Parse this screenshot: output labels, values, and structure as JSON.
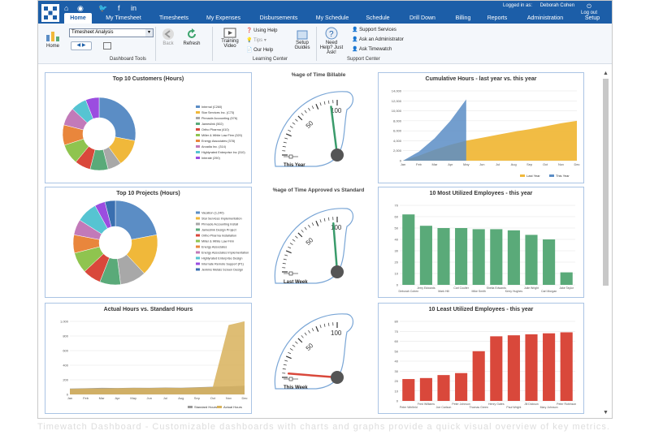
{
  "header": {
    "user_label": "Logged in as:",
    "user_name": "Deborah Cohen",
    "logout_label": "Log out",
    "tabs": [
      "Home",
      "My Timesheet",
      "Timesheets",
      "My Expenses",
      "Disbursements",
      "My Schedule",
      "Schedule",
      "Drill Down",
      "Billing",
      "Reports",
      "Administration",
      "Setup"
    ],
    "active_tab": "Home"
  },
  "ribbon": {
    "home_label": "Home",
    "dashboard_select": "Timesheet Analysis",
    "dashboard_tools_label": "Dashboard Tools",
    "back_label": "Back",
    "refresh_label": "Refresh",
    "training_label": "Training Video",
    "using_help_label": "Using Help",
    "tips_label": "Tips",
    "our_help_label": "Our Help",
    "setup_guides_label": "Setup Guides",
    "learning_center_label": "Learning Center",
    "need_help_label": "Need Help? Just Ask!",
    "support_services_label": "Support Services",
    "ask_admin_label": "Ask an Administrator",
    "ask_timewatch_label": "Ask Timewatch",
    "support_center_label": "Support Center"
  },
  "colors": {
    "brand": "#1c5ea8",
    "panel_border": "#aac4e4",
    "green_bar": "#5aaa79",
    "red_bar": "#d9483b",
    "area_blue": "#5b8dc5",
    "area_gold": "#f0b83a"
  },
  "panels": {
    "customers_title": "Top 10 Customers (Hours)",
    "projects_title": "Top 10 Projects (Hours)",
    "actual_title": "Actual Hours vs. Standard Hours",
    "billable_title": "%age of Time Billable",
    "approved_title": "%age of Time Approved vs Standard",
    "cumulative_title": "Cumulative Hours - last year vs. this year",
    "most_util_title": "10 Most Utilized Employees - this year",
    "least_util_title": "10 Least Utilized Employees - this year"
  },
  "gauges": [
    {
      "label": "This Year",
      "tick_50": "50",
      "tick_100": "100",
      "value": 92
    },
    {
      "label": "Last Week",
      "tick_50": "50",
      "tick_100": "100",
      "value": 95
    },
    {
      "label": "This Week",
      "tick_50": "50",
      "tick_100": "100",
      "value": 5
    }
  ],
  "chart_data": [
    {
      "type": "pie",
      "title": "Top 10 Customers (Hours)",
      "categories": [
        "Internal (C260)",
        "Star Services Inc. (C73)",
        "Pinnacle Accounting (576)",
        "Jameslink (502)",
        "Ortho Pharma (410)",
        "Miller & White Law Firm (320)",
        "Energy Associates (378)",
        "Arcadia Inc. (314)",
        "Highlyrated Enterprise Inc (310)",
        "Interate (290)"
      ],
      "values": [
        28,
        12,
        6,
        8,
        7,
        9,
        9,
        8,
        7,
        6
      ]
    },
    {
      "type": "pie",
      "title": "Top 10 Projects (Hours)",
      "categories": [
        "Vacation (1,240)",
        "Star Services Implementation",
        "Pinnacle Accounting Install",
        "Jameslink Design Project",
        "Ortho Pharma Installation",
        "Miller & White Law Firm",
        "Energy Associates",
        "Energy Associates Implementation",
        "Highlyrated Enterprise Design",
        "Internate Remote Support (P1)",
        "Jenkins Metals Screen Design"
      ],
      "values": [
        22,
        16,
        10,
        8,
        7,
        8,
        7,
        6,
        8,
        4,
        4
      ]
    },
    {
      "type": "area",
      "title": "Actual Hours vs. Standard Hours",
      "ylim": [
        0,
        1000
      ],
      "yticks": [
        "0",
        "200",
        "400",
        "600",
        "800",
        "1,000"
      ],
      "x": [
        "Jan",
        "Feb",
        "Mar",
        "Apr",
        "May",
        "Jun",
        "Jul",
        "Aug",
        "Sep",
        "Oct",
        "Nov",
        "Dec"
      ],
      "series": [
        {
          "name": "Standard Hours",
          "values": [
            80,
            85,
            90,
            88,
            92,
            90,
            95,
            92,
            98,
            105,
            110,
            120
          ]
        },
        {
          "name": "Actual Hours",
          "values": [
            75,
            80,
            82,
            85,
            88,
            86,
            90,
            88,
            95,
            100,
            950,
            1000
          ]
        }
      ]
    },
    {
      "type": "area",
      "title": "Cumulative Hours - last year vs. this year",
      "ylim": [
        0,
        14000
      ],
      "yticks": [
        "0",
        "2,000",
        "4,000",
        "6,000",
        "8,000",
        "10,000",
        "12,000",
        "14,000"
      ],
      "x": [
        "Jan",
        "Feb",
        "Mar",
        "Apr",
        "May",
        "Jun",
        "Jul",
        "Aug",
        "Sep",
        "Oct",
        "Nov",
        "Dec"
      ],
      "series": [
        {
          "name": "Last Year",
          "values": [
            0,
            1000,
            2200,
            3200,
            4000,
            4600,
            5200,
            5800,
            6300,
            6900,
            7500,
            8000
          ]
        },
        {
          "name": "This Year",
          "values": [
            0,
            1800,
            4500,
            8000,
            12300,
            null,
            null,
            null,
            null,
            null,
            null,
            null
          ]
        }
      ]
    },
    {
      "type": "bar",
      "title": "10 Most Utilized Employees - this year",
      "categories": [
        "Deborah Cohen",
        "Jerry Edwards",
        "Mark Hill",
        "Carl Coulter",
        "Mike Smith",
        "Sheila Edwards",
        "Kerry Hughes",
        "Julie Wright",
        "Carl Morgan",
        "Jake Taylor"
      ],
      "values": [
        62,
        52,
        50,
        50,
        49,
        49,
        48,
        44,
        40,
        11
      ]
    },
    {
      "type": "bar",
      "title": "10 Least Utilized Employees - this year",
      "categories": [
        "Peter Winfield",
        "Fred Williams",
        "Joe Carlson",
        "Peter Johnson",
        "Thomas Green",
        "Henry Gates",
        "Paul Wright",
        "Jill Dickson",
        "Mary Johnson",
        "Peter Robinson"
      ],
      "values": [
        22,
        23,
        26,
        28,
        50,
        65,
        66,
        67,
        68,
        69
      ]
    }
  ],
  "footer_text": "Timewatch Dashboard - Customizable dashboards with charts and graphs provide a quick visual overview of key metrics."
}
